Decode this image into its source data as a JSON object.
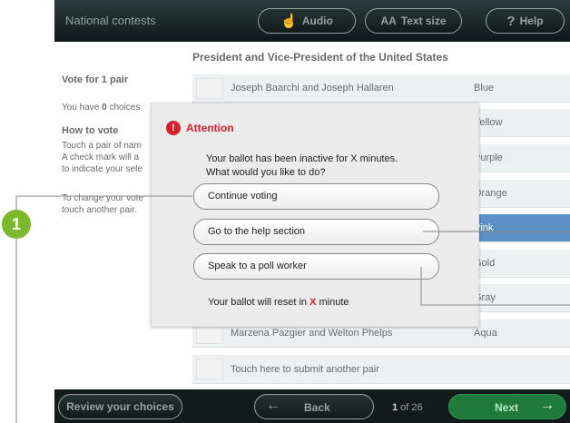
{
  "header": {
    "context": "National contests",
    "audio_label": "Audio",
    "textsize_label": "Text size",
    "help_label": "Help",
    "text_size_glyph": "AA"
  },
  "instructions": {
    "vote_for": "Vote for 1 pair",
    "choices_prefix": "You have ",
    "choices_count": "0",
    "choices_suffix": " choices",
    "how_heading": "How to vote",
    "how_line1": "Touch a pair of nam",
    "how_line2": "A check mark will a",
    "how_line3": "to indicate your sele",
    "change_line1": "To change your vote",
    "change_line2": "touch another pair."
  },
  "ballot": {
    "title": "President and Vice-President of the United States",
    "rows": [
      {
        "name": "Joseph Baarchi and Joseph Hallaren",
        "color": "Blue"
      },
      {
        "name": "",
        "color": "Yellow"
      },
      {
        "name": "",
        "color": "Purple"
      },
      {
        "name": "",
        "color": "Orange"
      },
      {
        "name": "",
        "color": "Pink",
        "selected": true
      },
      {
        "name": "",
        "color": "Gold"
      },
      {
        "name": "",
        "color": "Gray"
      },
      {
        "name": "Marzena Pazgier and Welton Phelps",
        "color": "Aqua"
      }
    ],
    "write_in": "Touch here to submit another pair"
  },
  "footer": {
    "review_label": "Review your choices",
    "back_label": "Back",
    "page_current": "1",
    "page_of": " of 26",
    "next_label": "Next"
  },
  "dialog": {
    "title": "Attention",
    "message_line1": "Your ballot has been inactive for X minutes.",
    "message_line2": "What would you like to do?",
    "buttons": [
      "Continue voting",
      "Go to the help section",
      "Speak to a poll worker"
    ],
    "reset_prefix": "Your ballot will reset in ",
    "reset_value": "X",
    "reset_suffix": " minute"
  },
  "callout": {
    "number": "1"
  },
  "colors": {
    "topbar": "#1a2626",
    "selected_row": "#0e5ea8",
    "warning": "#d4202a",
    "next": "#1f7a3c",
    "callout": "#7ab929"
  }
}
